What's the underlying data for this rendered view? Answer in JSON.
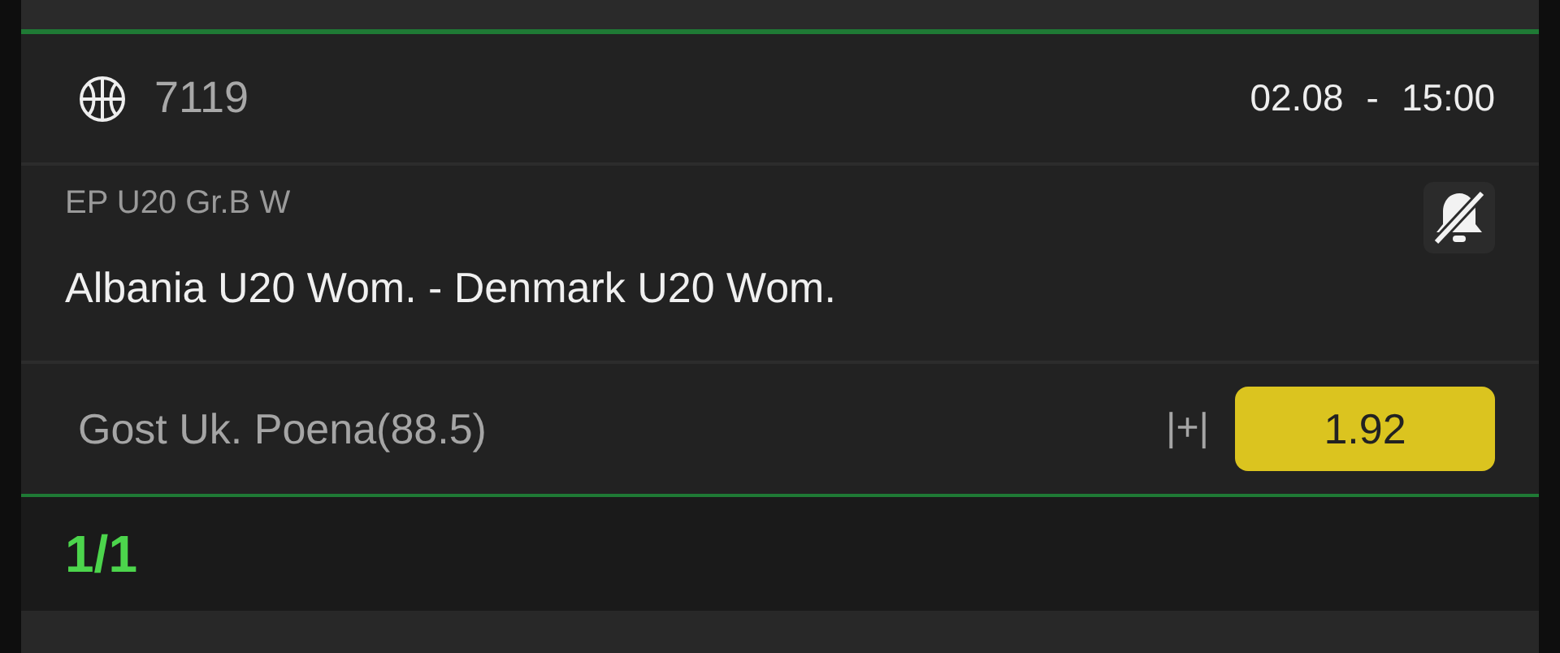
{
  "event": {
    "code": "7119",
    "date": "02.08",
    "separator": "-",
    "time": "15:00",
    "league": "EP U20 Gr.B W",
    "alerts_muted": true,
    "match": "Albania U20 Wom. - Denmark U20 Wom."
  },
  "bet": {
    "market": "Gost Uk. Poena(88.5)",
    "handicap_mark": "|+|",
    "odds": "1.92"
  },
  "footer": {
    "count": "1/1"
  }
}
